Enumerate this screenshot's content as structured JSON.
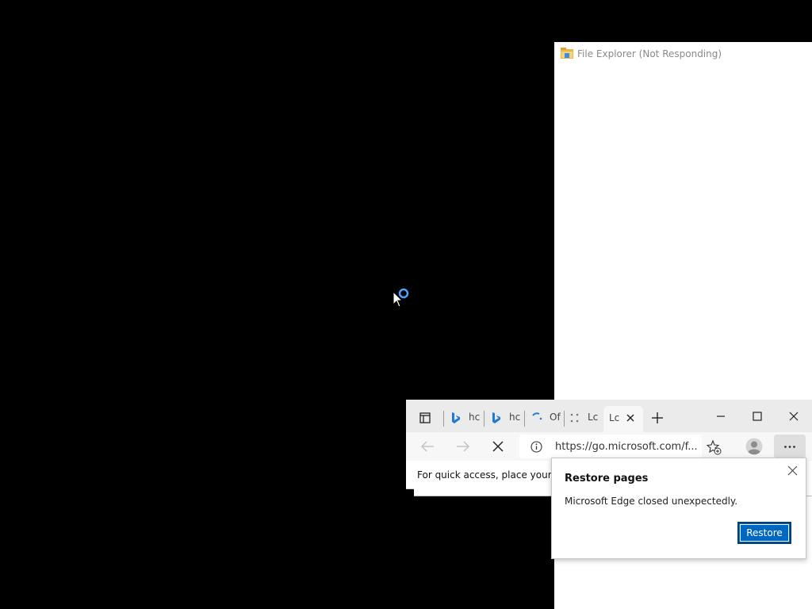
{
  "file_explorer": {
    "title": "File Explorer (Not Responding)",
    "icon": "folder-icon"
  },
  "edge": {
    "tabs": [
      {
        "label": "hc",
        "icon": "bing-icon"
      },
      {
        "label": "hc",
        "icon": "bing-icon"
      },
      {
        "label": "Of",
        "icon": "loading-icon"
      },
      {
        "label": "Lc",
        "icon": "loading-icon"
      }
    ],
    "active_tab": {
      "label": "Lc"
    },
    "address_bar": {
      "url": "https://go.microsoft.com/f..."
    },
    "favorites_bar_text": "For quick access, place your fav",
    "window_controls": [
      "minimize",
      "maximize",
      "close"
    ],
    "accent_color": "#0067c0"
  },
  "restore_popup": {
    "title": "Restore pages",
    "message": "Microsoft Edge closed unexpectedly.",
    "button_label": "Restore"
  }
}
